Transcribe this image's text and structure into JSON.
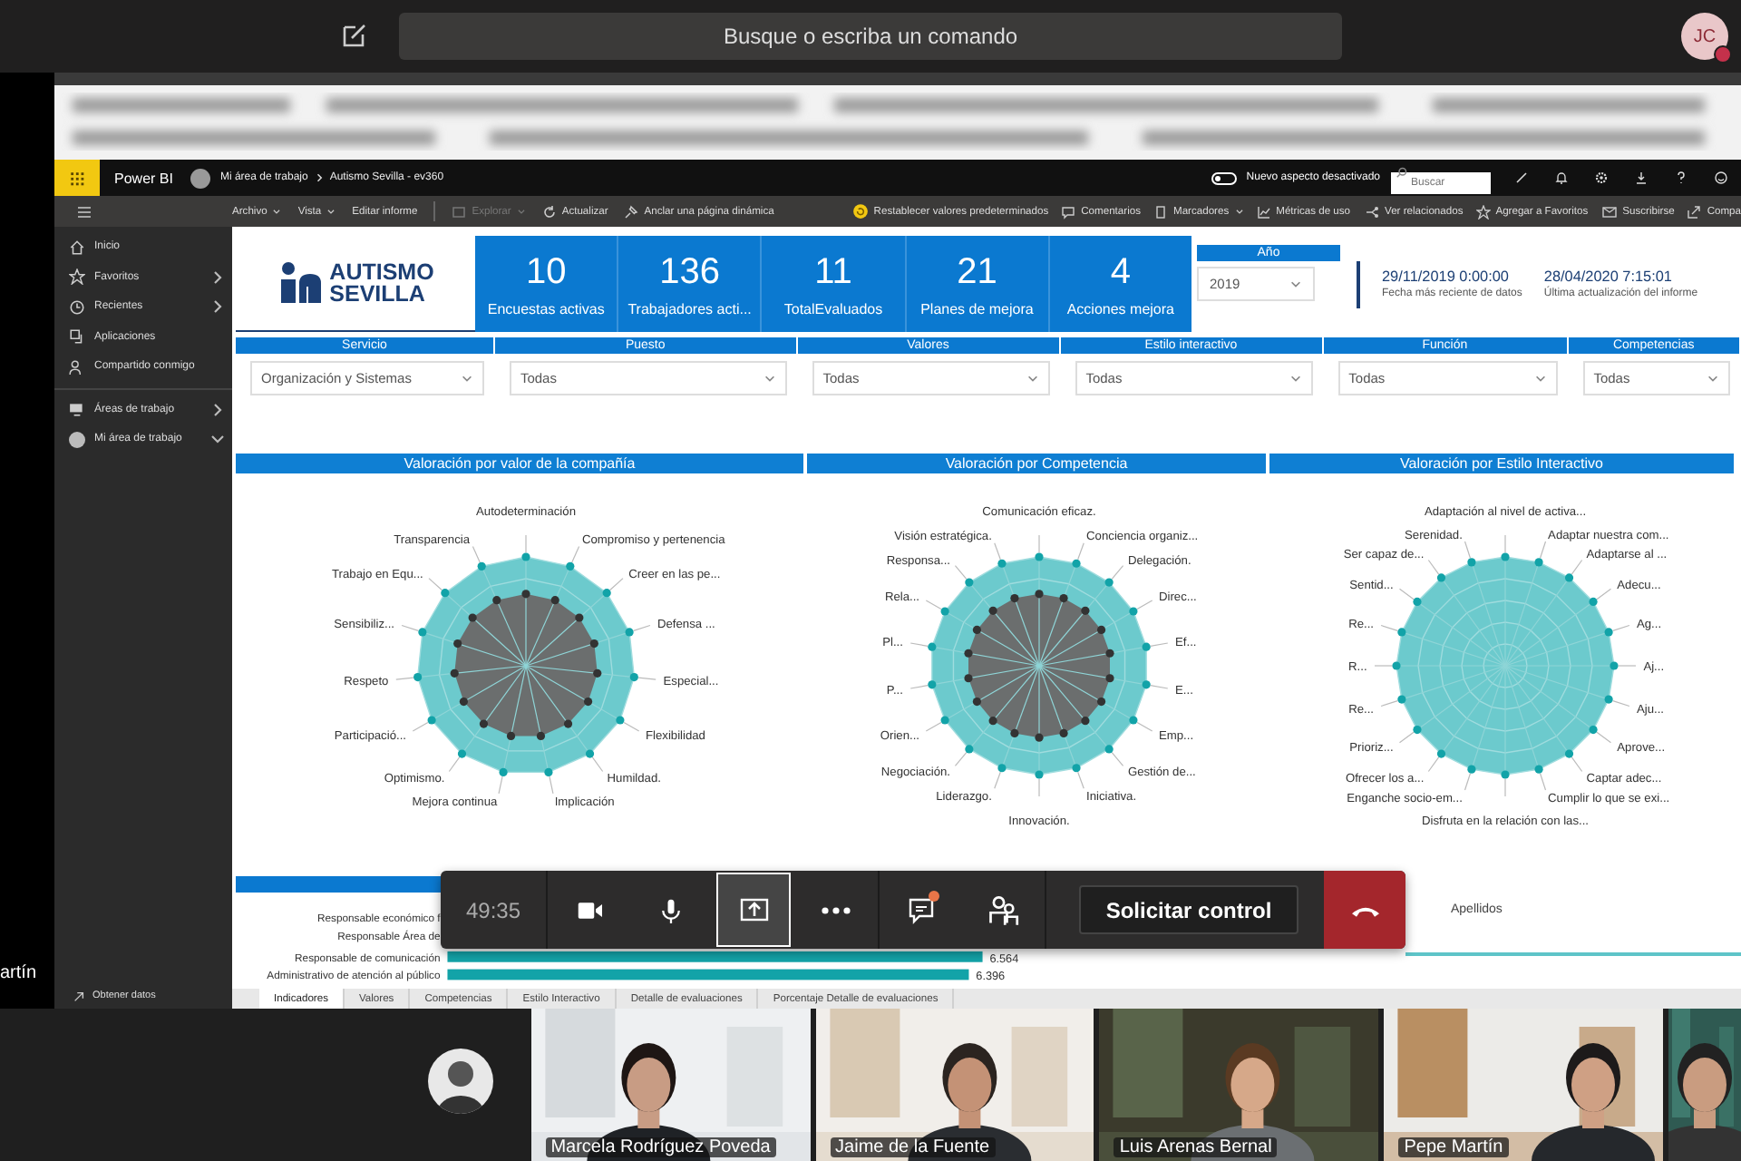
{
  "teams_bar": {
    "search_placeholder": "Busque o escriba un comando",
    "avatar_initials": "JC"
  },
  "side_label": "artín",
  "powerbi": {
    "app_name": "Power BI",
    "breadcrumb": [
      "Mi área de trabajo",
      "Autismo Sevilla - ev360"
    ],
    "toggle": {
      "label": "Nuevo aspecto desactivado",
      "on": false
    },
    "search_placeholder": "Buscar"
  },
  "commands_left": [
    {
      "label": "Archivo",
      "dropdown": true,
      "disabled": false
    },
    {
      "label": "Vista",
      "dropdown": true,
      "disabled": false
    },
    {
      "label": "Editar informe",
      "dropdown": false,
      "disabled": false
    },
    {
      "label": "Explorar",
      "dropdown": true,
      "disabled": true
    },
    {
      "label": "Actualizar",
      "dropdown": false,
      "disabled": false
    },
    {
      "label": "Anclar una página dinámica",
      "dropdown": false,
      "disabled": false
    }
  ],
  "commands_right": [
    {
      "label": "Restablecer valores predeterminados",
      "dropdown": false
    },
    {
      "label": "Comentarios",
      "dropdown": false
    },
    {
      "label": "Marcadores",
      "dropdown": true
    },
    {
      "label": "Métricas de uso",
      "dropdown": false
    },
    {
      "label": "Ver relacionados",
      "dropdown": false
    },
    {
      "label": "Agregar a Favoritos",
      "dropdown": false
    },
    {
      "label": "Suscribirse",
      "dropdown": false
    },
    {
      "label": "Compa",
      "dropdown": false
    }
  ],
  "sidebar": {
    "items": [
      {
        "label": "Inicio",
        "kind": "link"
      },
      {
        "label": "Favoritos",
        "kind": "group",
        "expanded": false
      },
      {
        "label": "Recientes",
        "kind": "group",
        "expanded": false
      },
      {
        "label": "Aplicaciones",
        "kind": "link"
      },
      {
        "label": "Compartido conmigo",
        "kind": "link"
      },
      {
        "label": "Áreas de trabajo",
        "kind": "group",
        "expanded": false
      },
      {
        "label": "Mi área de trabajo",
        "kind": "group",
        "expanded": true
      }
    ],
    "footer": "Obtener datos"
  },
  "report": {
    "logo": [
      "AUTISMO",
      "SEVILLA"
    ],
    "kpis": [
      {
        "value": "10",
        "label": "Encuestas activas"
      },
      {
        "value": "136",
        "label": "Trabajadores acti..."
      },
      {
        "value": "11",
        "label": "TotalEvaluados"
      },
      {
        "value": "21",
        "label": "Planes de mejora"
      },
      {
        "value": "4",
        "label": "Acciones mejora"
      }
    ],
    "year_slicer": {
      "title": "Año",
      "value": "2019"
    },
    "dates": [
      {
        "value": "29/11/2019 0:00:00",
        "caption": "Fecha más reciente de datos"
      },
      {
        "value": "28/04/2020 7:15:01",
        "caption": "Última actualización del informe"
      }
    ],
    "filters": [
      {
        "title": "Servicio",
        "value": "Organización y Sistemas"
      },
      {
        "title": "Puesto",
        "value": "Todas"
      },
      {
        "title": "Valores",
        "value": "Todas"
      },
      {
        "title": "Estilo interactivo",
        "value": "Todas"
      },
      {
        "title": "Función",
        "value": "Todas"
      },
      {
        "title": "Competencias",
        "value": "Todas"
      }
    ],
    "radar_charts": [
      {
        "title": "Valoración por valor de la compañía",
        "inner_series": true,
        "right_labels": [
          "Autodeterminación",
          "Compromiso y pertenencia",
          "Creer en las pe...",
          "Defensa ...",
          "Especial...",
          "Flexibilidad",
          "Humildad.",
          "Implicación"
        ],
        "left_labels": [
          "Transparencia",
          "Trabajo en Equ...",
          "Sensibiliz...",
          "Respeto",
          "Participació...",
          "Optimismo.",
          "Mejora continua"
        ]
      },
      {
        "title": "Valoración por Competencia",
        "inner_series": true,
        "right_labels": [
          "Comunicación eficaz.",
          "Conciencia organiz...",
          "Delegación.",
          "Direc...",
          "Ef...",
          "E...",
          "Emp...",
          "Gestión de...",
          "Iniciativa.",
          "Innovación."
        ],
        "left_labels": [
          "Visión estratégica.",
          "Responsa...",
          "Rela...",
          "Pl...",
          "P...",
          "Orien...",
          "Negociación.",
          "Liderazgo."
        ]
      },
      {
        "title": "Valoración por Estilo Interactivo",
        "inner_series": false,
        "right_labels": [
          "Adaptación al nivel de activa...",
          "Adaptar nuestra com...",
          "Adaptarse al ...",
          "Adecu...",
          "Ag...",
          "Aj...",
          "Aju...",
          "Aprove...",
          "Captar adec...",
          "Cumplir lo que se exi...",
          "Disfruta en la relación con las..."
        ],
        "left_labels": [
          "Serenidad.",
          "Ser capaz de...",
          "Sentid...",
          "Re...",
          "R...",
          "Re...",
          "Prioriz...",
          "Ofrecer los a...",
          "Enganche socio-em..."
        ]
      }
    ],
    "bottom_chart": {
      "chart_data": {
        "type": "bar",
        "orientation": "horizontal",
        "categories": [
          "Responsable económico f",
          "Responsable Área de",
          "Responsable de comunicación",
          "Administrativo de atención al público"
        ],
        "values": [
          null,
          null,
          6.564,
          6.396
        ],
        "data_labels": true
      }
    },
    "table": {
      "columns": [
        "Apellidos"
      ]
    },
    "page_tabs": [
      {
        "label": "Indicadores",
        "selected": true
      },
      {
        "label": "Valores",
        "selected": false
      },
      {
        "label": "Competencias",
        "selected": false
      },
      {
        "label": "Estilo Interactivo",
        "selected": false
      },
      {
        "label": "Detalle de evaluaciones",
        "selected": false
      },
      {
        "label": "Porcentaje Detalle de evaluaciones",
        "selected": false
      }
    ]
  },
  "meeting_controls": {
    "timer": "49:35",
    "sharing": true,
    "chat_unread": true,
    "request_button": "Solicitar control"
  },
  "participants": [
    {
      "name": "Marcela Rodríguez Poveda"
    },
    {
      "name": "Jaime de la Fuente"
    },
    {
      "name": "Luis Arenas Bernal"
    },
    {
      "name": "Pepe Martín"
    }
  ]
}
